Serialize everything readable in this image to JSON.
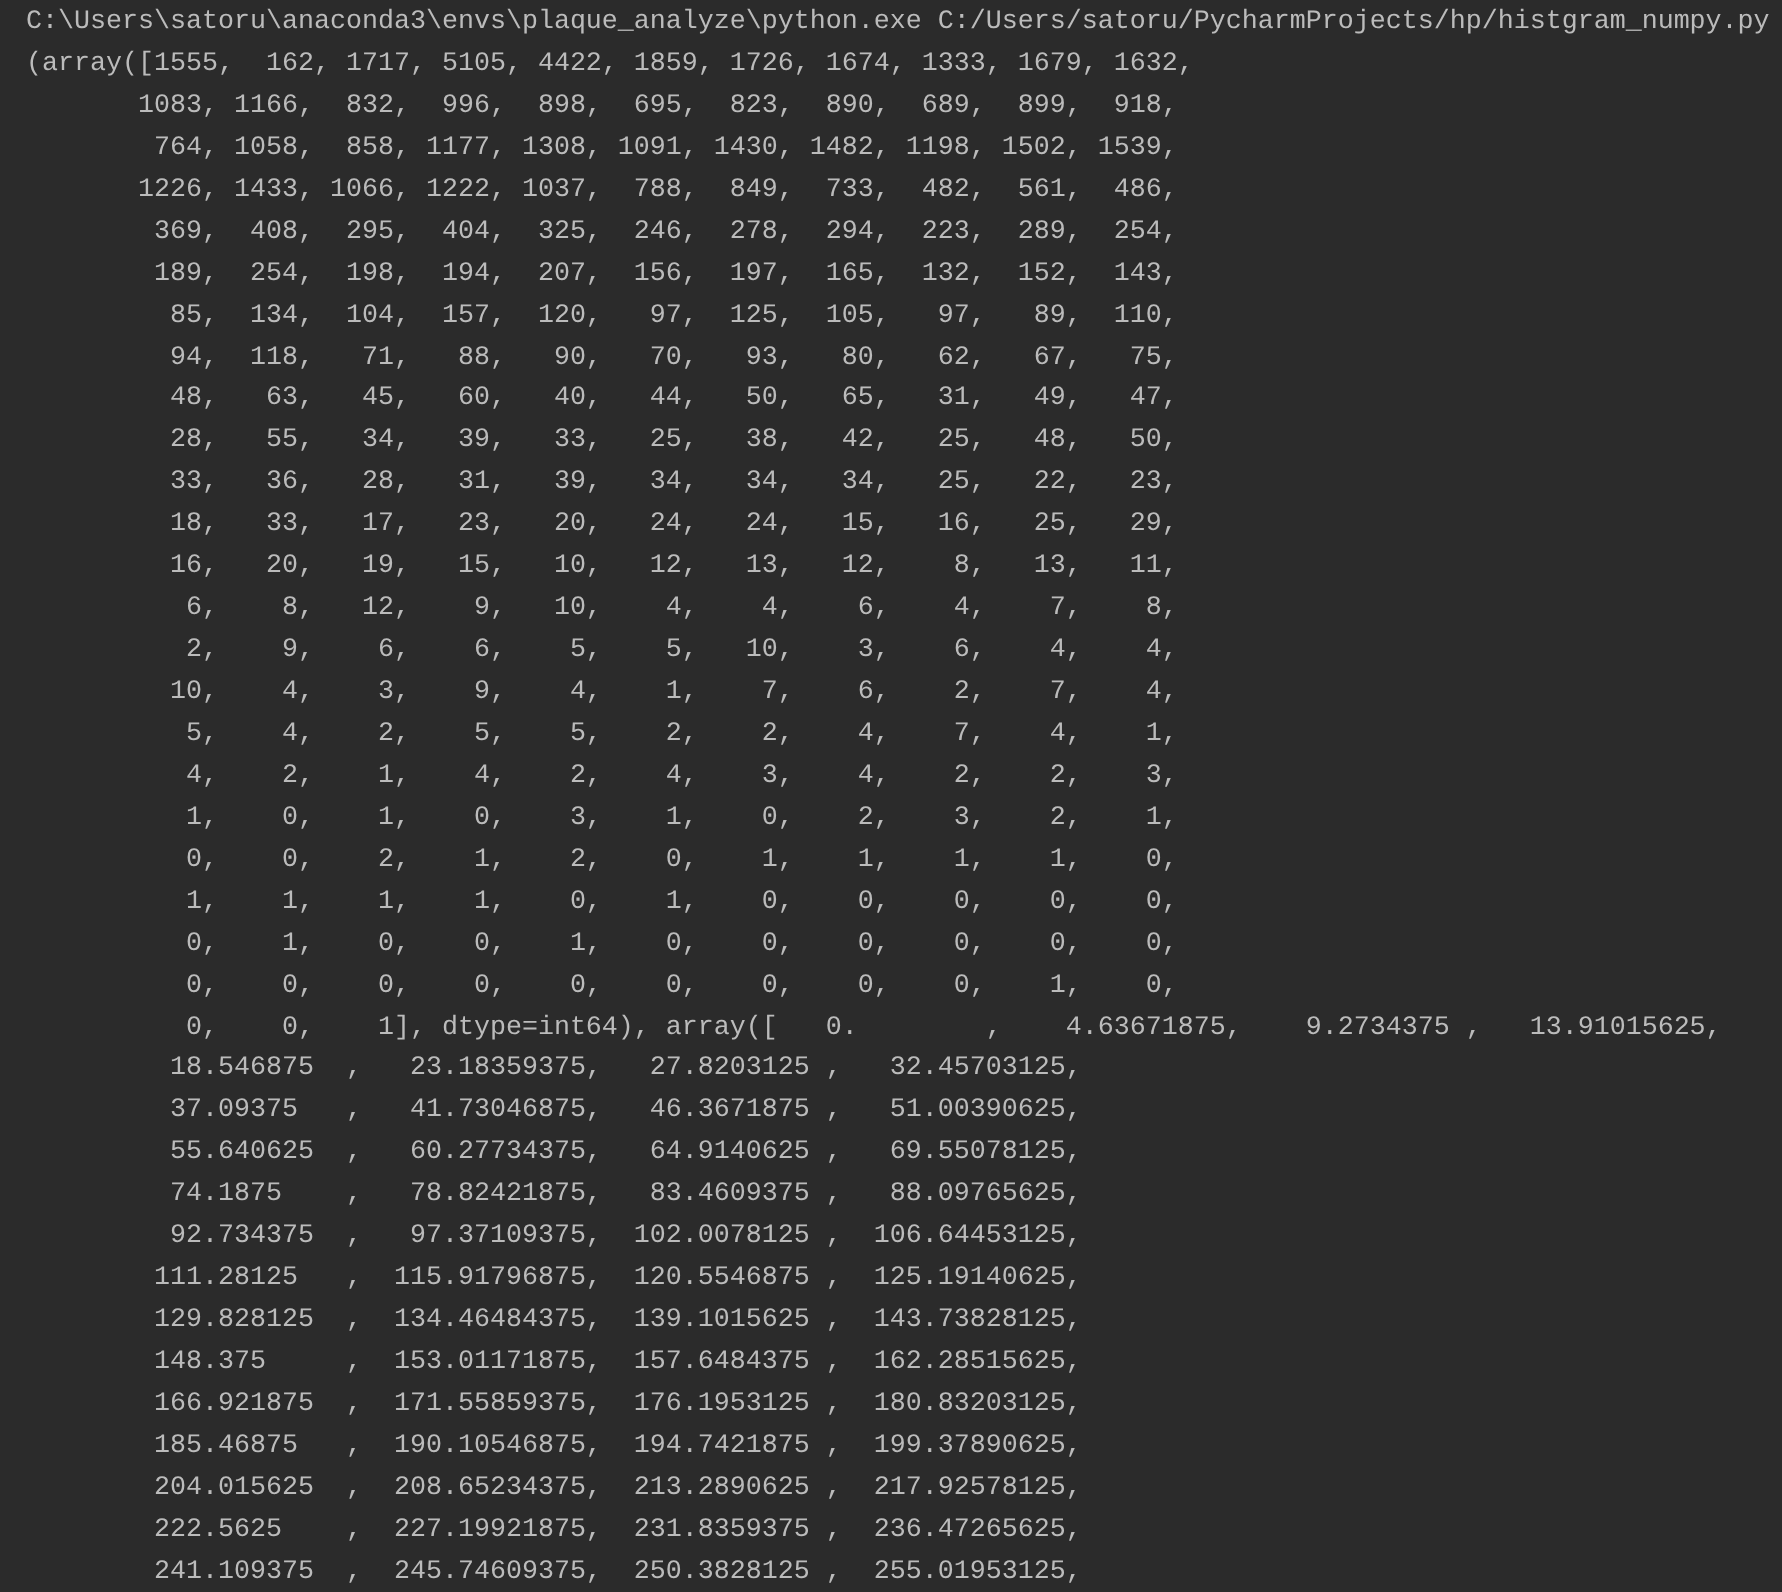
{
  "console": {
    "command": "C:\\Users\\satoru\\anaconda3\\envs\\plaque_analyze\\python.exe C:/Users/satoru/PycharmProjects/hp/histgram_numpy.py",
    "output_lines": [
      "(array([1555,  162, 1717, 5105, 4422, 1859, 1726, 1674, 1333, 1679, 1632,",
      "       1083, 1166,  832,  996,  898,  695,  823,  890,  689,  899,  918,",
      "        764, 1058,  858, 1177, 1308, 1091, 1430, 1482, 1198, 1502, 1539,",
      "       1226, 1433, 1066, 1222, 1037,  788,  849,  733,  482,  561,  486,",
      "        369,  408,  295,  404,  325,  246,  278,  294,  223,  289,  254,",
      "        189,  254,  198,  194,  207,  156,  197,  165,  132,  152,  143,",
      "         85,  134,  104,  157,  120,   97,  125,  105,   97,   89,  110,",
      "         94,  118,   71,   88,   90,   70,   93,   80,   62,   67,   75,",
      "         48,   63,   45,   60,   40,   44,   50,   65,   31,   49,   47,",
      "         28,   55,   34,   39,   33,   25,   38,   42,   25,   48,   50,",
      "         33,   36,   28,   31,   39,   34,   34,   34,   25,   22,   23,",
      "         18,   33,   17,   23,   20,   24,   24,   15,   16,   25,   29,",
      "         16,   20,   19,   15,   10,   12,   13,   12,    8,   13,   11,",
      "          6,    8,   12,    9,   10,    4,    4,    6,    4,    7,    8,",
      "          2,    9,    6,    6,    5,    5,   10,    3,    6,    4,    4,",
      "         10,    4,    3,    9,    4,    1,    7,    6,    2,    7,    4,",
      "          5,    4,    2,    5,    5,    2,    2,    4,    7,    4,    1,",
      "          4,    2,    1,    4,    2,    4,    3,    4,    2,    2,    3,",
      "          1,    0,    1,    0,    3,    1,    0,    2,    3,    2,    1,",
      "          0,    0,    2,    1,    2,    0,    1,    1,    1,    1,    0,",
      "          1,    1,    1,    1,    0,    1,    0,    0,    0,    0,    0,",
      "          0,    1,    0,    0,    1,    0,    0,    0,    0,    0,    0,",
      "          0,    0,    0,    0,    0,    0,    0,    0,    0,    1,    0,",
      "          0,    0,    1], dtype=int64), array([   0.        ,    4.63671875,    9.2734375 ,   13.91015625,",
      "         18.546875  ,   23.18359375,   27.8203125 ,   32.45703125,",
      "         37.09375   ,   41.73046875,   46.3671875 ,   51.00390625,",
      "         55.640625  ,   60.27734375,   64.9140625 ,   69.55078125,",
      "         74.1875    ,   78.82421875,   83.4609375 ,   88.09765625,",
      "         92.734375  ,   97.37109375,  102.0078125 ,  106.64453125,",
      "        111.28125   ,  115.91796875,  120.5546875 ,  125.19140625,",
      "        129.828125  ,  134.46484375,  139.1015625 ,  143.73828125,",
      "        148.375     ,  153.01171875,  157.6484375 ,  162.28515625,",
      "        166.921875  ,  171.55859375,  176.1953125 ,  180.83203125,",
      "        185.46875   ,  190.10546875,  194.7421875 ,  199.37890625,",
      "        204.015625  ,  208.65234375,  213.2890625 ,  217.92578125,",
      "        222.5625    ,  227.19921875,  231.8359375 ,  236.47265625,",
      "        241.109375  ,  245.74609375,  250.3828125 ,  255.01953125,"
    ]
  }
}
